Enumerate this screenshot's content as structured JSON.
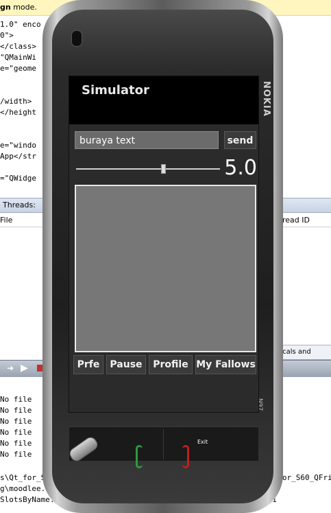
{
  "ide": {
    "top_bar_bold": "gn",
    "top_bar_text": " mode.",
    "code_lines": [
      "1.0\" enco",
      "0\">",
      "</class>",
      "\"QMainWi",
      "e=\"geome",
      "",
      "",
      "/width>",
      "</height",
      "",
      "",
      "e=\"windo",
      "App</str",
      "",
      "=\"QWidge"
    ],
    "threads_label": "Threads:",
    "file_col": "File",
    "thread_id_col": "read ID",
    "locals_tab": "ocals and Watch",
    "no_file_rows": [
      "No file",
      "No file",
      "No file",
      "No file",
      "No file",
      "No file"
    ],
    "console_lines": [
      "s\\Qt_for_S60_",
      "g\\moodlee.exe...",
      "SlotsByName: No matching signal for on moodpos valueChanged(i"
    ],
    "console_right": "t_for_S60_QFri"
  },
  "phone": {
    "brand": "NOKIA",
    "model": "N97"
  },
  "app": {
    "title": "Simulator",
    "text_input_value": "buraya text",
    "send_label": "send",
    "slider_value": 0.6,
    "lcd_value": "5.0",
    "buttons": {
      "prfe": "Prfe",
      "pause": "Pause",
      "profile": "Profile",
      "my_fallows": "My Fallows"
    },
    "softkey_right": "Exit"
  }
}
